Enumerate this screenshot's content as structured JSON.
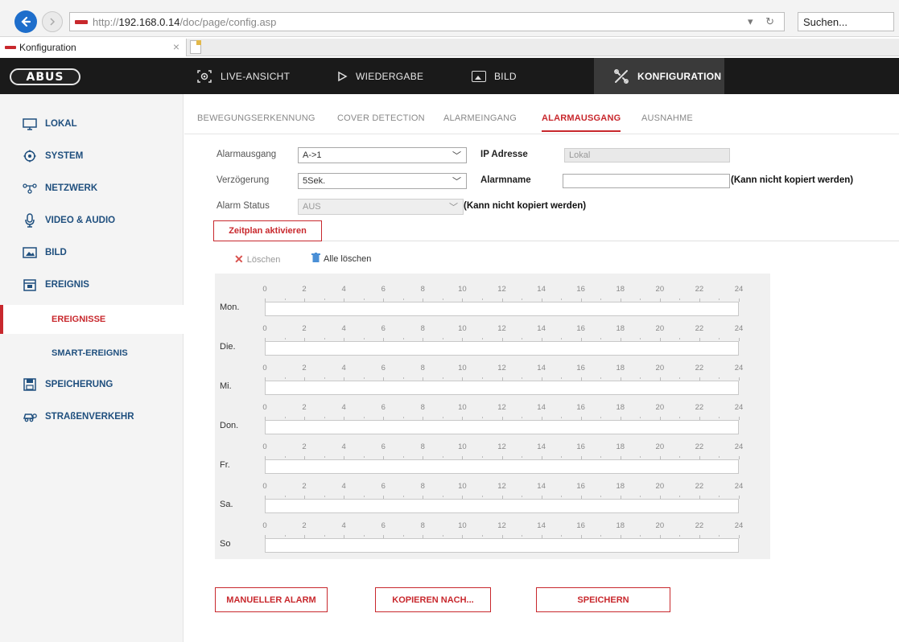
{
  "browser": {
    "url_prefix": "http://",
    "url_host": "192.168.0.14",
    "url_path": "/doc/page/config.asp",
    "search_placeholder": "Suchen...",
    "tab_title": "Konfiguration"
  },
  "brand": "ABUS",
  "top_nav": [
    {
      "label": "LIVE-ANSICHT",
      "icon": "camera-icon"
    },
    {
      "label": "WIEDERGABE",
      "icon": "play-icon"
    },
    {
      "label": "BILD",
      "icon": "image-icon"
    },
    {
      "label": "KONFIGURATION",
      "icon": "tools-icon",
      "active": true
    }
  ],
  "sidebar": {
    "items": [
      {
        "label": "LOKAL",
        "icon": "monitor-icon"
      },
      {
        "label": "SYSTEM",
        "icon": "gear-icon"
      },
      {
        "label": "NETZWERK",
        "icon": "network-icon"
      },
      {
        "label": "VIDEO & AUDIO",
        "icon": "microphone-icon"
      },
      {
        "label": "BILD",
        "icon": "image-icon"
      },
      {
        "label": "EREIGNIS",
        "icon": "calendar-icon"
      }
    ],
    "subitems": [
      {
        "label": "EREIGNISSE",
        "active": true
      },
      {
        "label": "SMART-EREIGNIS"
      }
    ],
    "items_after": [
      {
        "label": "SPEICHERUNG",
        "icon": "storage-icon"
      },
      {
        "label": "STRAßENVERKEHR",
        "icon": "car-icon"
      }
    ]
  },
  "subtabs": [
    {
      "label": "BEWEGUNGSERKENNUNG"
    },
    {
      "label": "COVER DETECTION"
    },
    {
      "label": "ALARMEINGANG"
    },
    {
      "label": "ALARMAUSGANG",
      "active": true
    },
    {
      "label": "AUSNAHME"
    }
  ],
  "form": {
    "alarmausgang_label": "Alarmausgang",
    "alarmausgang_value": "A->1",
    "verzoegerung_label": "Verzögerung",
    "verzoegerung_value": "5Sek.",
    "alarm_status_label": "Alarm Status",
    "alarm_status_value": "AUS",
    "alarm_status_note": "(Kann nicht kopiert werden)",
    "ip_label": "IP Adresse",
    "ip_value": "Lokal",
    "alarmname_label": "Alarmname",
    "alarmname_value": "",
    "alarmname_note": "(Kann nicht kopiert werden)"
  },
  "schedule_button": "Zeitplan aktivieren",
  "toolbar": {
    "delete_label": "Löschen",
    "delete_all_label": "Alle löschen"
  },
  "schedule": {
    "hours": [
      "0",
      "2",
      "4",
      "6",
      "8",
      "10",
      "12",
      "14",
      "16",
      "18",
      "20",
      "22",
      "24"
    ],
    "days": [
      "Mon.",
      "Die.",
      "Mi.",
      "Don.",
      "Fr.",
      "Sa.",
      "So"
    ]
  },
  "buttons": {
    "manual_alarm": "MANUELLER ALARM",
    "copy_to": "KOPIEREN NACH...",
    "save": "SPEICHERN"
  },
  "colors": {
    "accent": "#c8282d",
    "nav_bg": "#1a1a1a",
    "sidebar_text": "#1f4f7e"
  }
}
